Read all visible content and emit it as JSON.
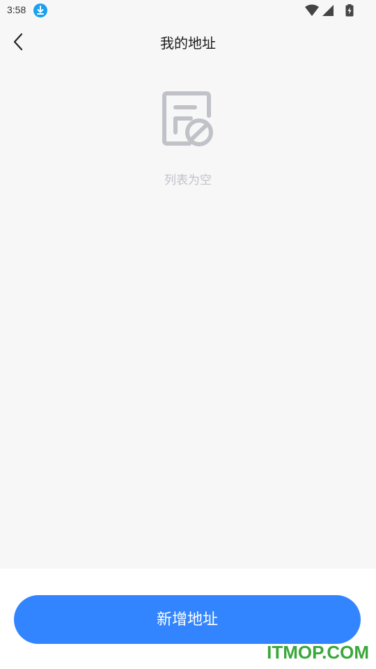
{
  "status_bar": {
    "time": "3:58",
    "icons": [
      "download-icon",
      "wifi-icon",
      "signal-icon",
      "battery-icon"
    ]
  },
  "header": {
    "title": "我的地址",
    "back_icon": "chevron-left-icon"
  },
  "empty_state": {
    "icon": "empty-list-icon",
    "text": "列表为空"
  },
  "footer": {
    "add_button_label": "新增地址"
  },
  "watermark": "ITMOP.COM",
  "colors": {
    "primary": "#3385ff",
    "background": "#f7f7f8",
    "empty_text": "#c0c2c8",
    "watermark": "#3aa73a"
  }
}
